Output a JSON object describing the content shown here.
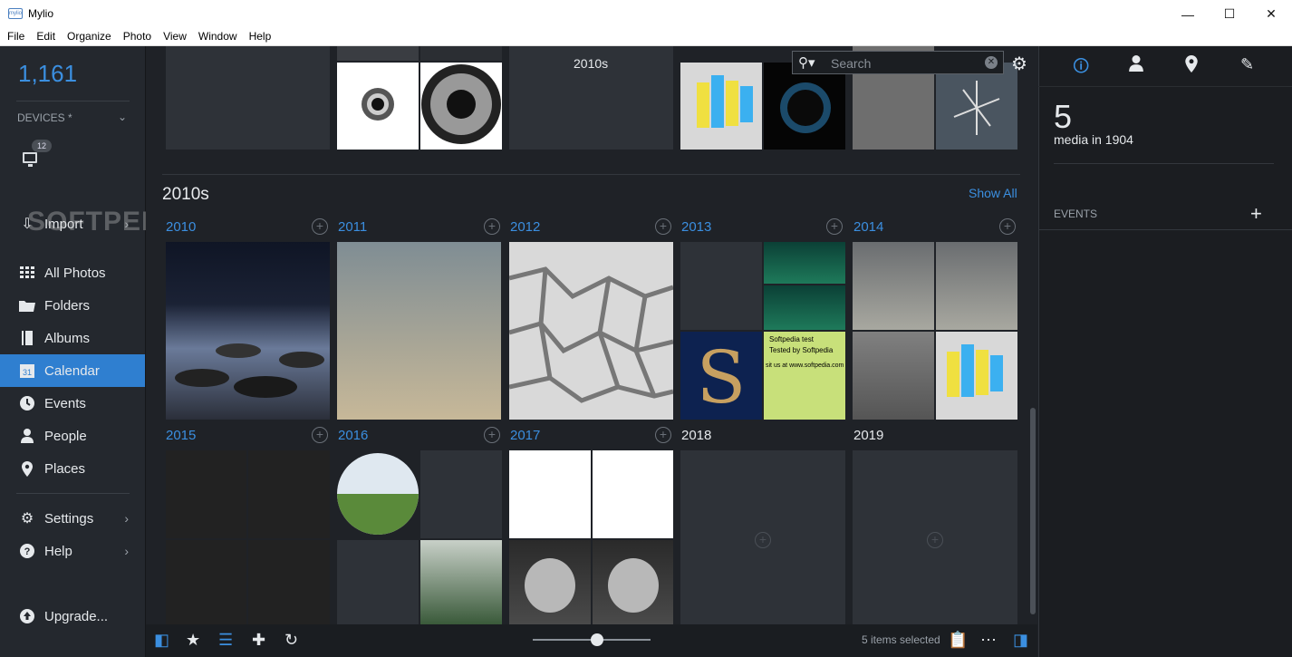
{
  "window": {
    "title": "Mylio",
    "app_icon": "mylio",
    "minimize": "—",
    "maximize": "☐",
    "close": "✕"
  },
  "menu": [
    "File",
    "Edit",
    "Organize",
    "Photo",
    "View",
    "Window",
    "Help"
  ],
  "sidebar": {
    "total_count": "1,161",
    "devices_label": "DEVICES *",
    "device_badge": "12",
    "import_label": "Import",
    "items": [
      {
        "label": "All Photos",
        "icon": "grid-icon"
      },
      {
        "label": "Folders",
        "icon": "folder-icon"
      },
      {
        "label": "Albums",
        "icon": "album-icon"
      },
      {
        "label": "Calendar",
        "icon": "calendar-icon",
        "icon_text": "31",
        "active": true
      },
      {
        "label": "Events",
        "icon": "clock-icon"
      },
      {
        "label": "People",
        "icon": "person-icon"
      },
      {
        "label": "Places",
        "icon": "pin-icon"
      }
    ],
    "settings_label": "Settings",
    "help_label": "Help",
    "upgrade_label": "Upgrade..."
  },
  "toolbar": {
    "decade": "2010s",
    "search_placeholder": "Search"
  },
  "section": {
    "title": "2010s",
    "show_all": "Show All",
    "years": [
      "2010",
      "2011",
      "2012",
      "2013",
      "2014",
      "2015",
      "2016",
      "2017",
      "2018",
      "2019"
    ]
  },
  "watermark": "SOFTPEDIA",
  "tile_text": {
    "softpedia_test": "Softpedia test",
    "tested_by": "Tested by Softpedia",
    "visit": "sit us at www.softpedia.com"
  },
  "bottom": {
    "selected_text": "5 items selected"
  },
  "right_panel": {
    "media_count": "5",
    "media_caption": "media in 1904",
    "events_label": "EVENTS"
  },
  "colors": {
    "accent": "#3b8fe0",
    "sidebar_bg": "#24282e",
    "content_bg": "#1f2227",
    "active_nav": "#2f7fd0"
  }
}
